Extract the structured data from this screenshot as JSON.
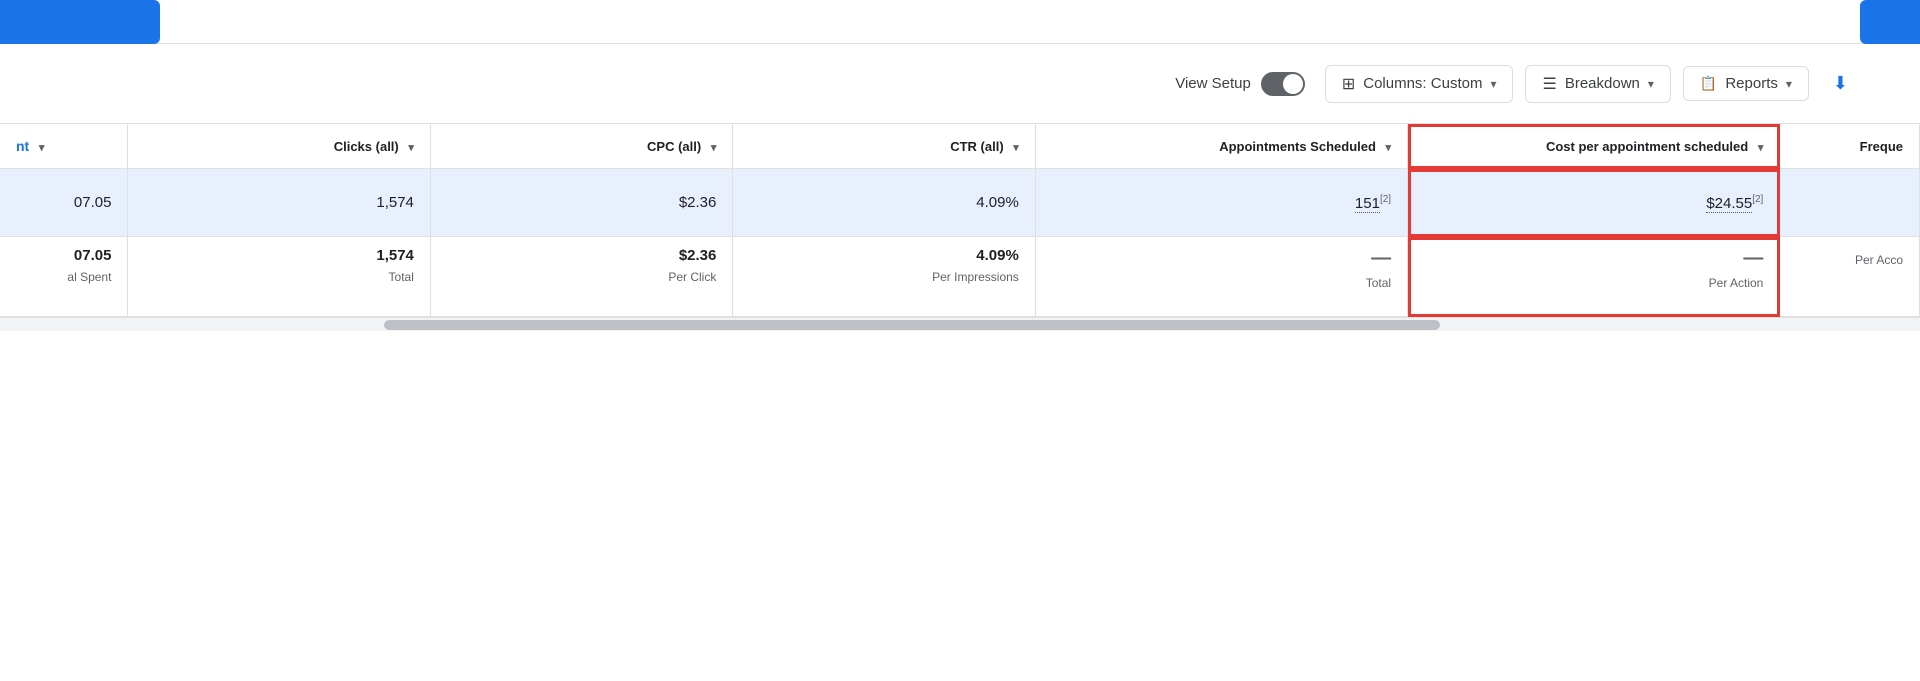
{
  "header": {
    "left_button_color": "#1a73e8",
    "right_button_color": "#1a73e8"
  },
  "toolbar": {
    "view_setup_label": "View Setup",
    "columns_label": "Columns: Custom",
    "breakdown_label": "Breakdown",
    "reports_label": "Reports"
  },
  "table": {
    "columns": [
      {
        "id": "metric",
        "label": "nt",
        "sort": true
      },
      {
        "id": "clicks",
        "label": "Clicks (all)",
        "sort": true
      },
      {
        "id": "cpc",
        "label": "CPC (all)",
        "sort": true
      },
      {
        "id": "ctr",
        "label": "CTR (all)",
        "sort": true
      },
      {
        "id": "appointments",
        "label": "Appointments Scheduled",
        "sort": true
      },
      {
        "id": "cost_per",
        "label": "Cost per appointment scheduled",
        "sort": true,
        "highlighted": true
      },
      {
        "id": "frequency",
        "label": "Freque",
        "sort": false
      }
    ],
    "data_row": {
      "metric": "07.05",
      "clicks": "1,574",
      "cpc": "$2.36",
      "ctr": "4.09%",
      "appointments": "151",
      "appointments_sup": "[2]",
      "cost_per": "$24.55",
      "cost_per_sup": "[2]",
      "frequency": ""
    },
    "totals_row": {
      "metric_value": "07.05",
      "metric_label": "al Spent",
      "clicks_value": "1,574",
      "clicks_label": "Total",
      "cpc_value": "$2.36",
      "cpc_label": "Per Click",
      "ctr_value": "4.09%",
      "ctr_label": "Per Impressions",
      "appointments_value": "—",
      "appointments_label": "Total",
      "cost_per_value": "—",
      "cost_per_label": "Per Action",
      "frequency_value": "",
      "frequency_label": "Per Acco"
    }
  },
  "scrollbar": {
    "visible": true
  }
}
